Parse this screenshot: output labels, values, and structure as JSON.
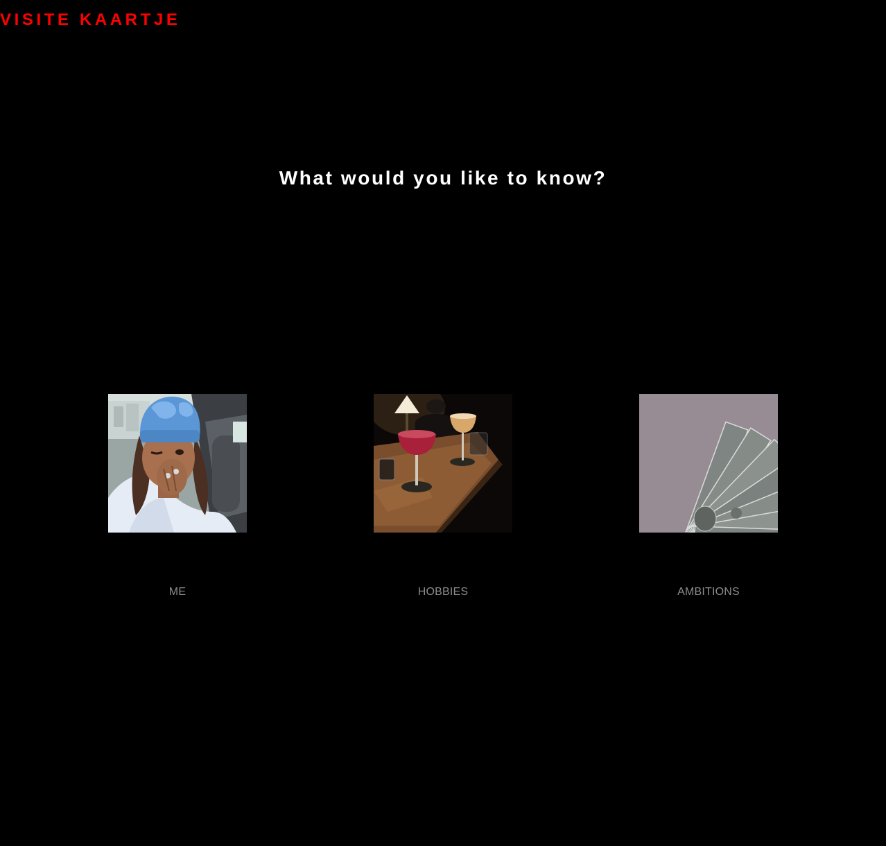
{
  "header": {
    "brand": "VISITE KAARTJE"
  },
  "main": {
    "heading": "What would you like to know?",
    "tiles": [
      {
        "label": "ME",
        "image": "selfie-photo"
      },
      {
        "label": "HOBBIES",
        "image": "cocktails-photo"
      },
      {
        "label": "AMBITIONS",
        "image": "money-photo"
      }
    ]
  },
  "colors": {
    "background": "#000000",
    "brand": "#ff0000",
    "heading": "#ffffff",
    "tile_label": "#8c8c8c"
  }
}
